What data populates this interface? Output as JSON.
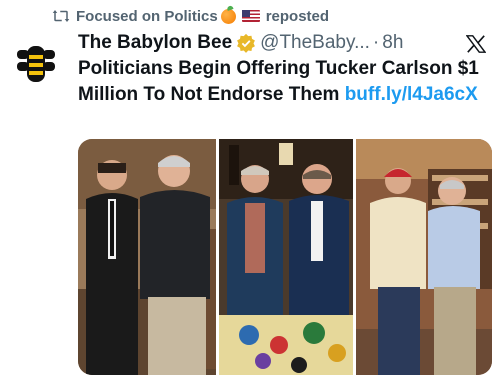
{
  "repost": {
    "label": "Focused on Politics",
    "suffix": "reposted",
    "icon": "repost-icon",
    "emojis": [
      "orange-emoji",
      "us-flag-emoji"
    ]
  },
  "tweet": {
    "author_name": "The Babylon Bee",
    "handle": "@TheBaby...",
    "separator": "·",
    "time": "8h",
    "text": "Politicians Begin Offering Tucker Carlson $1 Million To Not Endorse Them",
    "link": "buff.ly/l4Ja6cX"
  },
  "media": {
    "photos": [
      "photo-1",
      "photo-2",
      "photo-3"
    ]
  },
  "colors": {
    "muted": "#536471",
    "link": "#1d9bf0",
    "verified_gold": "#e8b829"
  }
}
